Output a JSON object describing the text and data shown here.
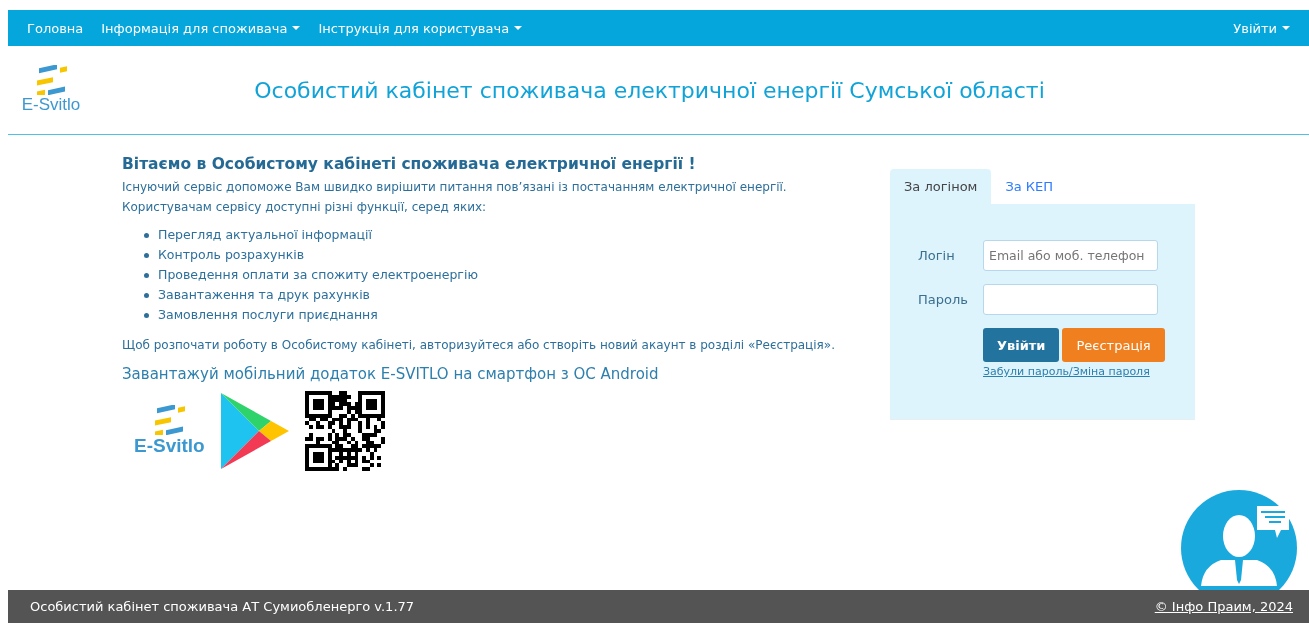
{
  "nav": {
    "items": [
      {
        "label": "Головна",
        "dropdown": false
      },
      {
        "label": "Інформація для споживача",
        "dropdown": true
      },
      {
        "label": "Інструкція для користувача",
        "dropdown": true
      }
    ],
    "login": {
      "label": "Увійти",
      "dropdown": true
    }
  },
  "header": {
    "logo_text": "E-Svitlo",
    "title": "Особистий кабінет споживача електричної енергії Сумської області"
  },
  "intro": {
    "heading": "Вітаємо в Особистому кабінеті споживача електричної енергії !",
    "lines": [
      "Існуючий сервіс допоможе Вам швидко вирішити питання пов’язані із постачанням електричної енергії.",
      "Користувачам сервісу доступні різні функції, серед яких:"
    ],
    "features": [
      "Перегляд актуальної інформації",
      "Контроль розрахунків",
      "Проведення оплати за спожиту електроенергію",
      "Завантаження та друк рахунків",
      "Замовлення послуги приєднання"
    ],
    "note": "Щоб розпочати роботу в Особистому кабінеті, авторизуйтеся або створіть новий акаунт в розділі «Реєстрація».",
    "app_heading": "Завантажуй мобільний додаток E-SVITLO на смартфон з ОС Android",
    "app_logo_text": "E-Svitlo"
  },
  "login_panel": {
    "tabs": [
      {
        "label": "За логіном",
        "selected": true
      },
      {
        "label": "За КЕП",
        "selected": false
      }
    ],
    "login_label": "Логін",
    "login_placeholder": "Email або моб. телефон",
    "password_label": "Пароль",
    "buttons": [
      {
        "label": "Увійти",
        "kind": "primary"
      },
      {
        "label": "Реєстрація",
        "kind": "warning"
      }
    ],
    "forgot_link": "Забули пароль/Зміна пароля"
  },
  "footer": {
    "left": "Особистий кабінет споживача АТ Сумиобленерго v.1.77",
    "right": "© Інфо Праим, 2024"
  }
}
